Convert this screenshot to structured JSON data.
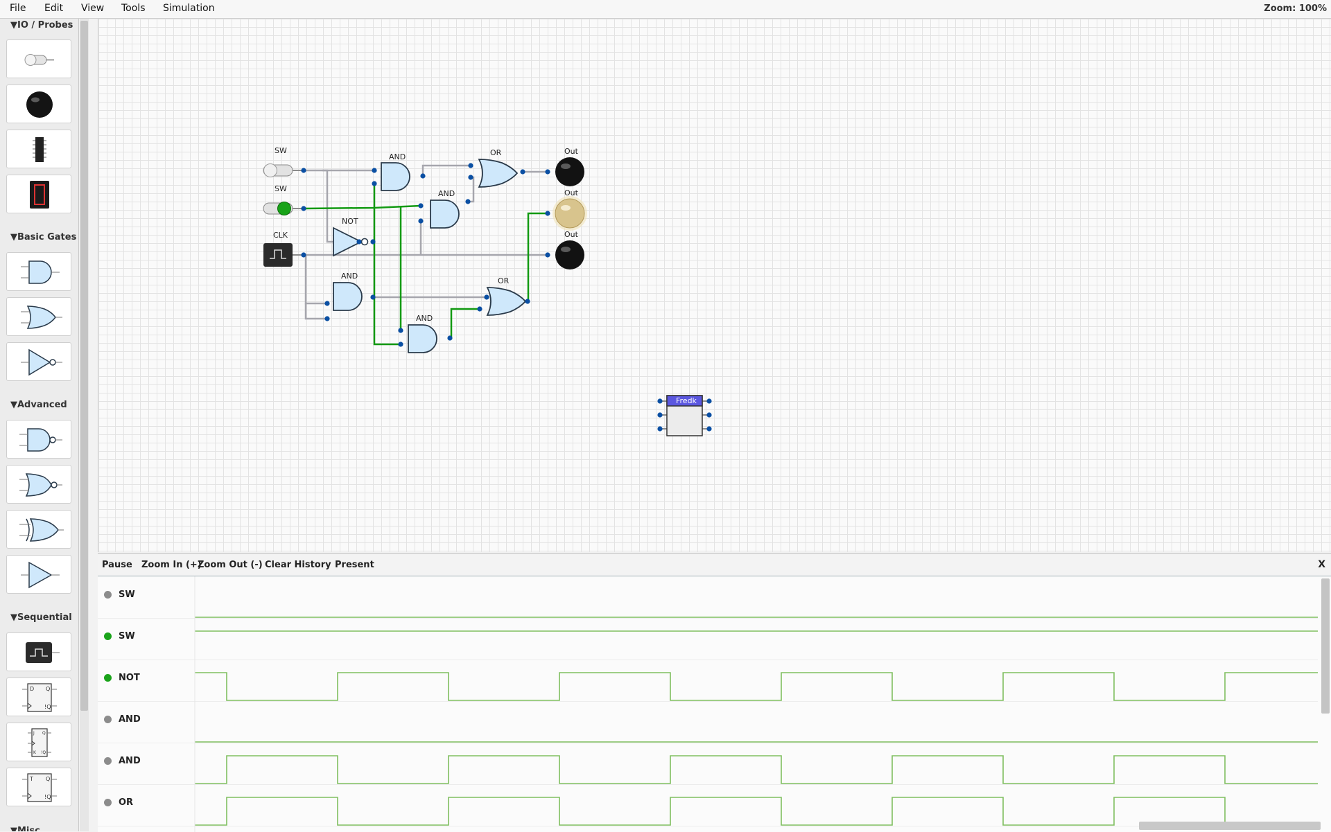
{
  "menu": {
    "file": "File",
    "edit": "Edit",
    "view": "View",
    "tools": "Tools",
    "simulation": "Simulation"
  },
  "zoom_label": "Zoom: 100%",
  "sidebar": {
    "sections": {
      "io": "▼IO / Probes",
      "basic": "▼Basic Gates",
      "advanced": "▼Advanced",
      "sequential": "▼Sequential",
      "misc": "▼Misc"
    },
    "tools": [
      "switch-icon",
      "light-bulb-icon",
      "chip-icon",
      "seven-segment-icon",
      "and-gate-icon",
      "or-gate-icon",
      "not-gate-icon",
      "nand-gate-icon",
      "nor-gate-icon",
      "xor-gate-icon",
      "buffer-icon",
      "clock-icon",
      "d-flipflop-icon",
      "jk-flipflop-icon",
      "t-flipflop-icon"
    ]
  },
  "circuit": {
    "labels": {
      "sw1": "SW",
      "sw2": "SW",
      "clk": "CLK",
      "not": "NOT",
      "and1": "AND",
      "and2": "AND",
      "and3": "AND",
      "and4": "AND",
      "or1": "OR",
      "or2": "OR",
      "out1": "Out",
      "out2": "Out",
      "out3": "Out",
      "fredkin": "Fredk"
    },
    "colors": {
      "wire_on": "#129a12",
      "wire_off": "#a6a6ad",
      "gate_fill": "#cfe8fb",
      "pin": "#0a4fa3",
      "bulb_on": "#d8c48d"
    }
  },
  "timing": {
    "buttons": {
      "pause": "Pause",
      "zoom_in": "Zoom In (+)",
      "zoom_out": "Zoom Out (-)",
      "clear": "Clear History",
      "present": "Present"
    },
    "close": "X",
    "signals": [
      {
        "name": "SW",
        "active": false,
        "wave": "low"
      },
      {
        "name": "SW",
        "active": true,
        "wave": "high"
      },
      {
        "name": "NOT",
        "active": true,
        "wave": "clock_inverted"
      },
      {
        "name": "AND",
        "active": false,
        "wave": "low"
      },
      {
        "name": "AND",
        "active": false,
        "wave": "clock"
      },
      {
        "name": "OR",
        "active": false,
        "wave": "clock"
      }
    ],
    "colors": {
      "dot_active": "#1aa31a",
      "dot_idle": "#8c8c8c",
      "wave": "#7fbf60"
    }
  }
}
